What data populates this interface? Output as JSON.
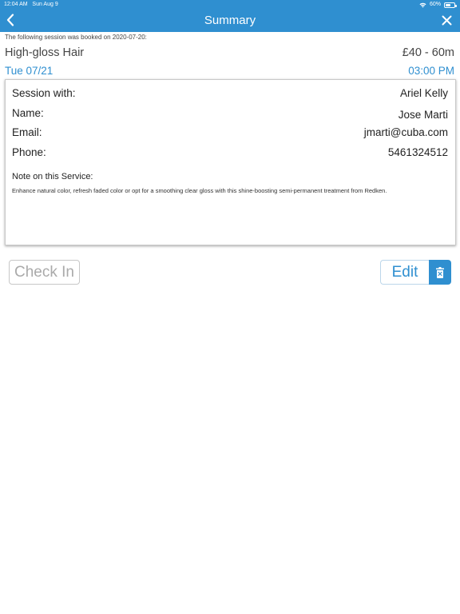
{
  "status_bar": {
    "time": "12:04 AM",
    "date": "Sun Aug 9",
    "battery": "60%",
    "battery_level": 0.6
  },
  "header": {
    "title": "Summary",
    "back_icon": "chevron-left-icon",
    "close_icon": "close-icon",
    "color": "#2f8fd0"
  },
  "booking": {
    "booked_note": "The following session was booked on 2020-07-20:",
    "service_name": "High-gloss Hair",
    "price_duration": "£40 - 60m",
    "date": "Tue 07/21",
    "time": "03:00 PM"
  },
  "details": {
    "session_with_label": "Session with:",
    "session_with_value": "Ariel Kelly",
    "name_label": "Name:",
    "name_value": "Jose Marti",
    "email_label": "Email:",
    "email_value": "jmarti@cuba.com",
    "phone_label": "Phone:",
    "phone_value": "5461324512",
    "note_heading": "Note on this Service:",
    "note_text": "Enhance natural color, refresh faded color or opt for a smoothing clear gloss with this shine-boosting semi-permanent treatment from Redken."
  },
  "actions": {
    "check_in_label": "Check In",
    "edit_label": "Edit",
    "delete_icon": "trash-icon"
  }
}
